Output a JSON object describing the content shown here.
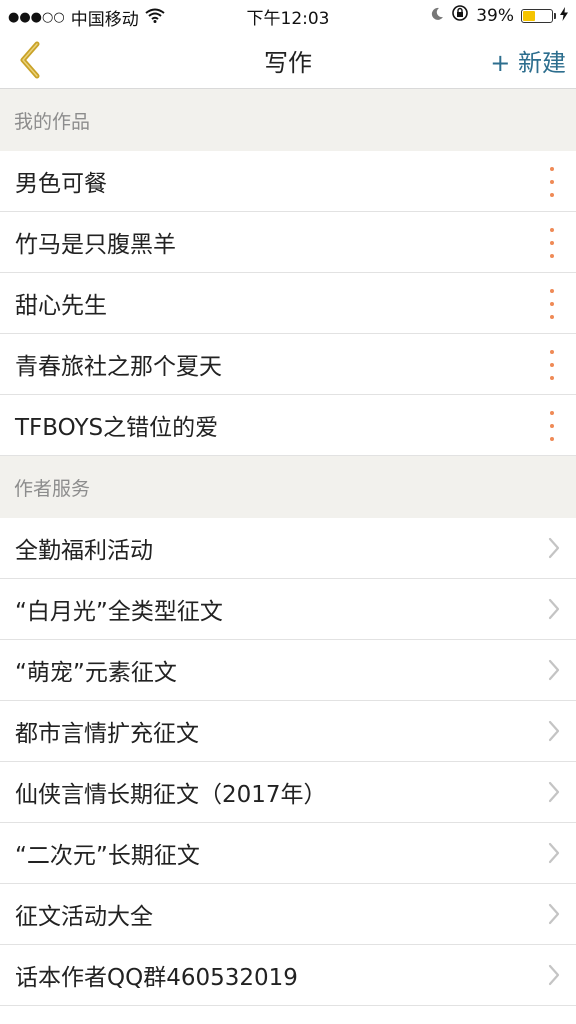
{
  "status_bar": {
    "signal": "●●●○○",
    "carrier": "中国移动",
    "time": "下午12:03",
    "battery": "39%",
    "battery_level": 0.39
  },
  "nav": {
    "title": "写作",
    "new_label": "+ 新建"
  },
  "works": {
    "header": "我的作品",
    "items": [
      {
        "label": "男色可餐"
      },
      {
        "label": "竹马是只腹黑羊"
      },
      {
        "label": "甜心先生"
      },
      {
        "label": "青春旅社之那个夏天"
      },
      {
        "label": "TFBOYS之错位的爱"
      }
    ]
  },
  "services": {
    "header": "作者服务",
    "items": [
      {
        "label": "全勤福利活动"
      },
      {
        "label": "“白月光”全类型征文"
      },
      {
        "label": "“萌宠”元素征文"
      },
      {
        "label": "都市言情扩充征文"
      },
      {
        "label": "仙侠言情长期征文（2017年）"
      },
      {
        "label": "“二次元”长期征文"
      },
      {
        "label": "征文活动大全"
      },
      {
        "label": "话本作者QQ群460532019"
      }
    ]
  },
  "colors": {
    "accent_blue": "#2d6e8e",
    "back_gold": "#c9a227",
    "more_orange": "#ef8a56",
    "section_bg": "#f2f1ed"
  }
}
